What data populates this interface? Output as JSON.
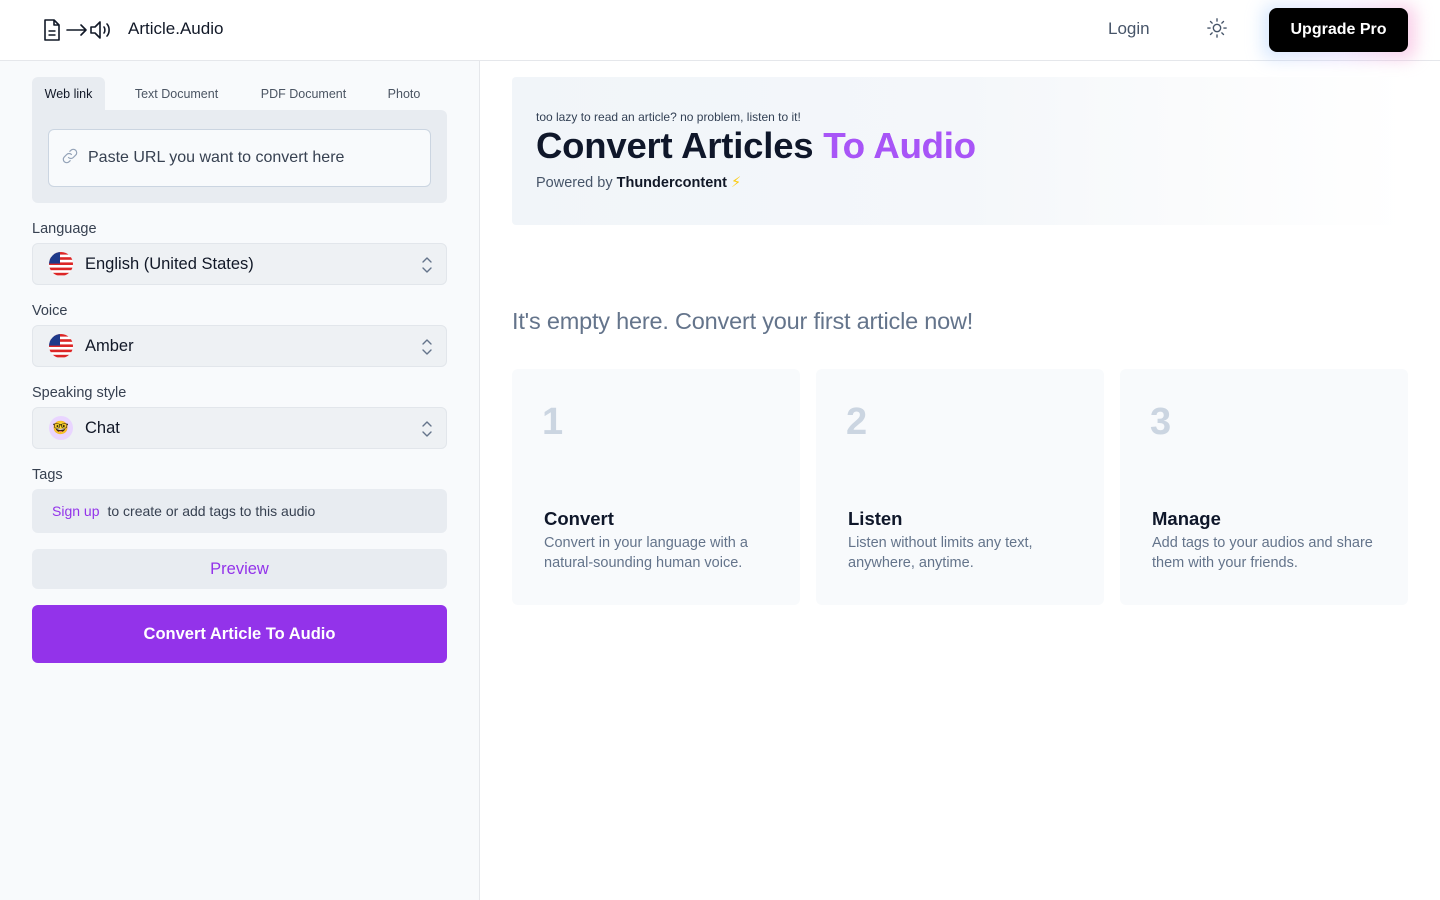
{
  "header": {
    "brand": "Article.Audio",
    "login_label": "Login",
    "upgrade_label": "Upgrade Pro",
    "icons": [
      "document-icon",
      "arrow-right-icon",
      "speaker-icon",
      "sun-icon"
    ]
  },
  "sidebar": {
    "tabs": [
      {
        "label": "Web link",
        "active": true
      },
      {
        "label": "Text Document",
        "active": false
      },
      {
        "label": "PDF Document",
        "active": false
      },
      {
        "label": "Photo",
        "active": false
      }
    ],
    "url_placeholder": "Paste URL you want to convert here",
    "language": {
      "label": "Language",
      "value": "English (United States)"
    },
    "voice": {
      "label": "Voice",
      "value": "Amber"
    },
    "speaking_style": {
      "label": "Speaking style",
      "value": "Chat",
      "emoji": "🤓"
    },
    "tags": {
      "label": "Tags",
      "signup_link": "Sign up",
      "text": "to create or add tags to this audio"
    },
    "preview_label": "Preview",
    "convert_label": "Convert Article To Audio"
  },
  "hero": {
    "tagline": "too lazy to read an article? no problem, listen to it!",
    "title_main": "Convert Articles ",
    "title_accent": "To Audio",
    "powered_prefix": "Powered by ",
    "powered_brand": "Thundercontent",
    "powered_icon": "⚡"
  },
  "empty_message": "It's empty here. Convert your first article now!",
  "steps": [
    {
      "number": "1",
      "title": "Convert",
      "description": "Convert in your language with a natural-sounding human voice."
    },
    {
      "number": "2",
      "title": "Listen",
      "description": "Listen without limits any text, anywhere, anytime."
    },
    {
      "number": "3",
      "title": "Manage",
      "description": "Add tags to your audios and share them with your friends."
    }
  ],
  "colors": {
    "accent": "#9333ea",
    "upgrade_bg": "#000000"
  }
}
